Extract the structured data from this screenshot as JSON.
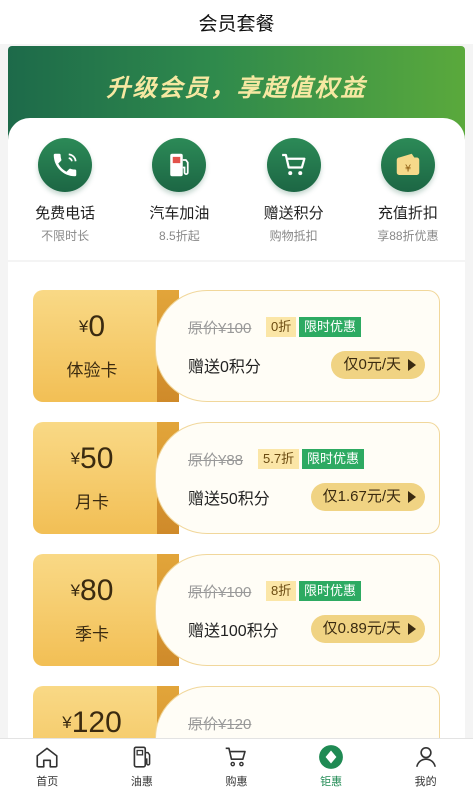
{
  "header": {
    "title": "会员套餐"
  },
  "hero": {
    "slogan": "升级会员，享超值权益"
  },
  "benefits": [
    {
      "name": "免费电话",
      "desc": "不限时长",
      "icon": "phone-icon"
    },
    {
      "name": "汽车加油",
      "desc": "8.5折起",
      "icon": "fuel-pump-icon"
    },
    {
      "name": "赠送积分",
      "desc": "购物抵扣",
      "icon": "cart-icon"
    },
    {
      "name": "充值折扣",
      "desc": "享88折优惠",
      "icon": "wallet-icon"
    }
  ],
  "plans": [
    {
      "currency": "¥",
      "price": "0",
      "name": "体验卡",
      "original": "原价¥100",
      "discount": "0折",
      "tag": "限时优惠",
      "points": "赠送0积分",
      "per_day": "仅0元/天"
    },
    {
      "currency": "¥",
      "price": "50",
      "name": "月卡",
      "original": "原价¥88",
      "discount": "5.7折",
      "tag": "限时优惠",
      "points": "赠送50积分",
      "per_day": "仅1.67元/天"
    },
    {
      "currency": "¥",
      "price": "80",
      "name": "季卡",
      "original": "原价¥100",
      "discount": "8折",
      "tag": "限时优惠",
      "points": "赠送100积分",
      "per_day": "仅0.89元/天"
    },
    {
      "currency": "¥",
      "price": "120",
      "name": "",
      "original": "原价¥120",
      "discount": "",
      "tag": "",
      "points": "",
      "per_day": ""
    }
  ],
  "tabbar": {
    "items": [
      {
        "label": "首页",
        "icon": "home-icon"
      },
      {
        "label": "油惠",
        "icon": "fuel-pump-icon"
      },
      {
        "label": "购惠",
        "icon": "cart-icon"
      },
      {
        "label": "钜惠",
        "icon": "diamond-icon",
        "active": true
      },
      {
        "label": "我的",
        "icon": "user-icon"
      }
    ]
  },
  "colors": {
    "brand_green": "#1f7a50",
    "gold": "#f2bf55",
    "tag_green": "#2daa62"
  }
}
